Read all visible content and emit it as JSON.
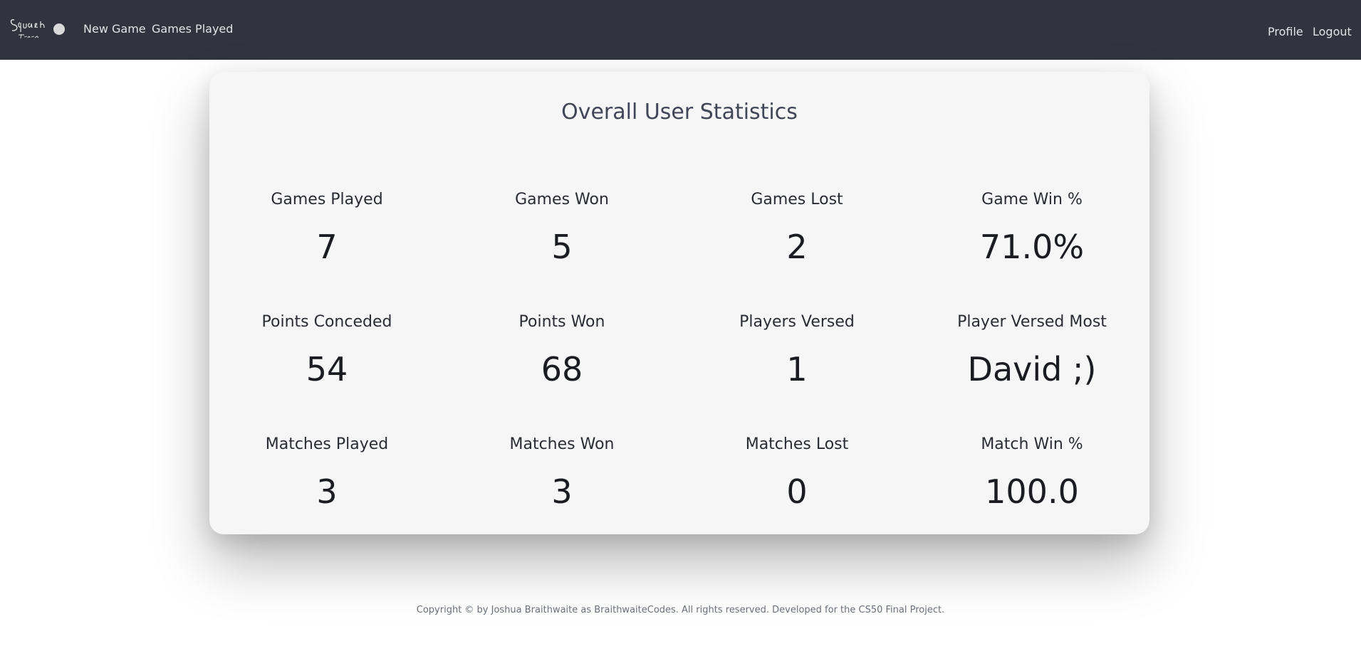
{
  "navbar": {
    "logo_text": "Squash Tracker",
    "links": {
      "new_game": "New Game",
      "games_played": "Games Played",
      "profile": "Profile",
      "logout": "Logout"
    },
    "background_color": "#31333e"
  },
  "stats": {
    "title": "Overall User Statistics",
    "items": [
      {
        "label": "Games Played",
        "value": "7"
      },
      {
        "label": "Games Won",
        "value": "5"
      },
      {
        "label": "Games Lost",
        "value": "2"
      },
      {
        "label": "Game Win %",
        "value": "71.0%"
      },
      {
        "label": "Points Conceded",
        "value": "54"
      },
      {
        "label": "Points Won",
        "value": "68"
      },
      {
        "label": "Players Versed",
        "value": "1"
      },
      {
        "label": "Player Versed Most",
        "value": "David ;)"
      },
      {
        "label": "Matches Played",
        "value": "3"
      },
      {
        "label": "Matches Won",
        "value": "3"
      },
      {
        "label": "Matches Lost",
        "value": "0"
      },
      {
        "label": "Match Win %",
        "value": "100.0"
      }
    ]
  },
  "footer": {
    "text": "Copyright © by Joshua Braithwaite as BraithwaiteCodes. All rights reserved. Developed for the CS50 Final Project."
  }
}
